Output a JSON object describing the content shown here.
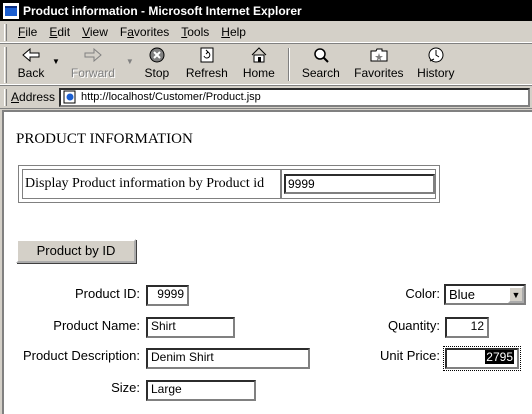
{
  "window": {
    "title": "Product information - Microsoft Internet Explorer"
  },
  "menu": {
    "items": [
      {
        "key": "F",
        "rest": "ile"
      },
      {
        "key": "E",
        "rest": "dit"
      },
      {
        "key": "V",
        "rest": "iew"
      },
      {
        "key": "",
        "pre": "F",
        "keyIn": "a",
        "post": "vorites"
      },
      {
        "key": "T",
        "rest": "ools"
      },
      {
        "key": "H",
        "rest": "elp"
      }
    ]
  },
  "toolbar": {
    "back": "Back",
    "forward": "Forward",
    "stop": "Stop",
    "refresh": "Refresh",
    "home": "Home",
    "search": "Search",
    "favorites": "Favorites",
    "history": "History"
  },
  "address": {
    "label_key": "A",
    "label_rest": "ddress",
    "url": "http://localhost/Customer/Product.jsp"
  },
  "page": {
    "heading": "PRODUCT INFORMATION",
    "search_label": "Display Product information by Product id",
    "search_value": "9999",
    "button_label": "Product by ID"
  },
  "form": {
    "product_id_label": "Product ID:",
    "product_id_value": "9999",
    "product_name_label": "Product Name:",
    "product_name_value": "Shirt",
    "product_description_label": "Product Description:",
    "product_description_value": "Denim Shirt",
    "size_label": "Size:",
    "size_value": "Large",
    "color_label": "Color:",
    "color_value": "Blue",
    "quantity_label": "Quantity:",
    "quantity_value": "12",
    "unit_price_label": "Unit Price:",
    "unit_price_value": "2795"
  }
}
